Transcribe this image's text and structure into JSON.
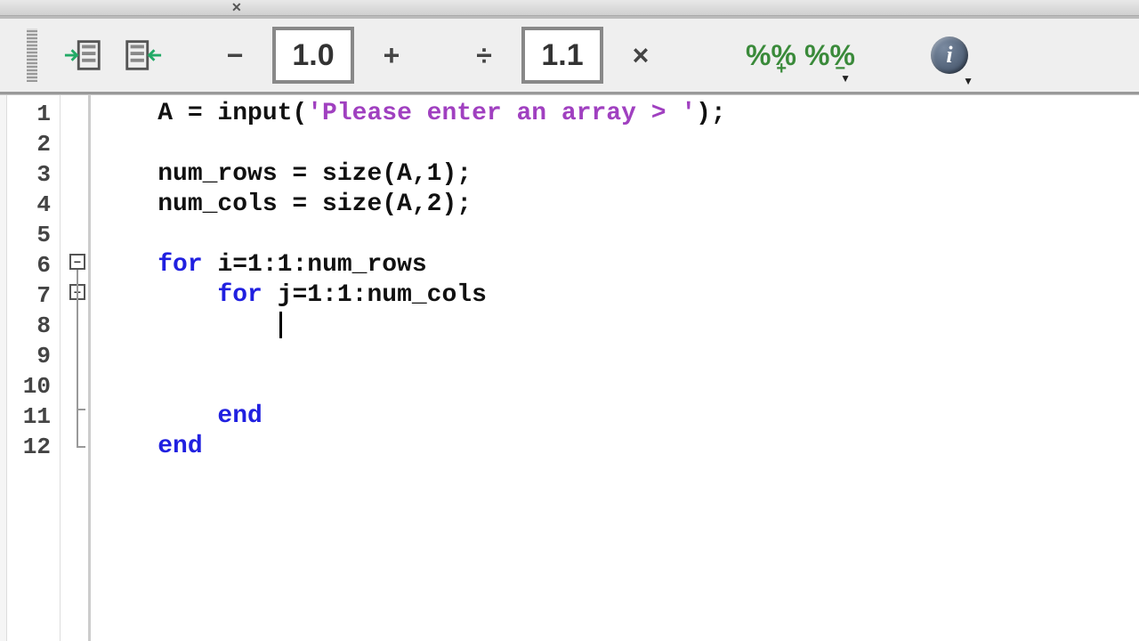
{
  "titlebar": {
    "close_label": "✕"
  },
  "toolbar": {
    "indent_value": "1.0",
    "step_value": "1.1",
    "minus": "−",
    "plus": "+",
    "divide": "÷",
    "times": "×",
    "info": "i"
  },
  "editor": {
    "line_numbers": [
      "1",
      "2",
      "3",
      "4",
      "5",
      "6",
      "7",
      "8",
      "9",
      "10",
      "11",
      "12"
    ],
    "fold_minus": "−",
    "code": {
      "l1_a": "    A = input(",
      "l1_str": "'Please enter an array > '",
      "l1_b": ");",
      "l2": "",
      "l3": "    num_rows = size(A,1);",
      "l4": "    num_cols = size(A,2);",
      "l5": "",
      "l6_kw": "for",
      "l6_rest": " i=1:1:num_rows",
      "l7_pad": "        ",
      "l7_kw": "for",
      "l7_rest": " j=1:1:num_cols",
      "l8_pad": "            ",
      "l9": "",
      "l10": "",
      "l11_pad": "        ",
      "l11_kw": "end",
      "l12_pad": "    ",
      "l12_kw": "end"
    }
  }
}
